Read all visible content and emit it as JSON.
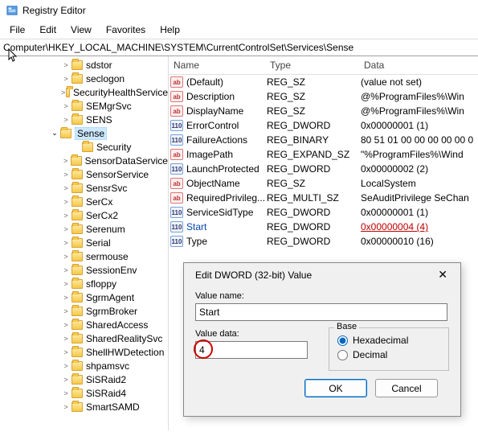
{
  "title": "Registry Editor",
  "menus": [
    "File",
    "Edit",
    "View",
    "Favorites",
    "Help"
  ],
  "address": "Computer\\HKEY_LOCAL_MACHINE\\SYSTEM\\CurrentControlSet\\Services\\Sense",
  "tree": [
    {
      "label": "sdstor",
      "chev": ">"
    },
    {
      "label": "seclogon",
      "chev": ">"
    },
    {
      "label": "SecurityHealthService",
      "chev": ">"
    },
    {
      "label": "SEMgrSvc",
      "chev": ">"
    },
    {
      "label": "SENS",
      "chev": ">"
    },
    {
      "label": "Sense",
      "chev": "v",
      "selected": true
    },
    {
      "label": "Security",
      "child": true
    },
    {
      "label": "SensorDataService",
      "chev": ">"
    },
    {
      "label": "SensorService",
      "chev": ">"
    },
    {
      "label": "SensrSvc",
      "chev": ">"
    },
    {
      "label": "SerCx",
      "chev": ">"
    },
    {
      "label": "SerCx2",
      "chev": ">"
    },
    {
      "label": "Serenum",
      "chev": ">"
    },
    {
      "label": "Serial",
      "chev": ">"
    },
    {
      "label": "sermouse",
      "chev": ">"
    },
    {
      "label": "SessionEnv",
      "chev": ">"
    },
    {
      "label": "sfloppy",
      "chev": ">"
    },
    {
      "label": "SgrmAgent",
      "chev": ">"
    },
    {
      "label": "SgrmBroker",
      "chev": ">"
    },
    {
      "label": "SharedAccess",
      "chev": ">"
    },
    {
      "label": "SharedRealitySvc",
      "chev": ">"
    },
    {
      "label": "ShellHWDetection",
      "chev": ">"
    },
    {
      "label": "shpamsvc",
      "chev": ">"
    },
    {
      "label": "SiSRaid2",
      "chev": ">"
    },
    {
      "label": "SiSRaid4",
      "chev": ">"
    },
    {
      "label": "SmartSAMD",
      "chev": ">"
    }
  ],
  "columns": {
    "name": "Name",
    "type": "Type",
    "data": "Data"
  },
  "values": [
    {
      "icon": "str",
      "name": "(Default)",
      "type": "REG_SZ",
      "data": "(value not set)"
    },
    {
      "icon": "str",
      "name": "Description",
      "type": "REG_SZ",
      "data": "@%ProgramFiles%\\Win"
    },
    {
      "icon": "str",
      "name": "DisplayName",
      "type": "REG_SZ",
      "data": "@%ProgramFiles%\\Win"
    },
    {
      "icon": "bin",
      "name": "ErrorControl",
      "type": "REG_DWORD",
      "data": "0x00000001 (1)"
    },
    {
      "icon": "bin",
      "name": "FailureActions",
      "type": "REG_BINARY",
      "data": "80 51 01 00 00 00 00 00 0"
    },
    {
      "icon": "str",
      "name": "ImagePath",
      "type": "REG_EXPAND_SZ",
      "data": "\"%ProgramFiles%\\Wind"
    },
    {
      "icon": "bin",
      "name": "LaunchProtected",
      "type": "REG_DWORD",
      "data": "0x00000002 (2)"
    },
    {
      "icon": "str",
      "name": "ObjectName",
      "type": "REG_SZ",
      "data": "LocalSystem"
    },
    {
      "icon": "str",
      "name": "RequiredPrivileg...",
      "type": "REG_MULTI_SZ",
      "data": "SeAuditPrivilege SeChan"
    },
    {
      "icon": "bin",
      "name": "ServiceSidType",
      "type": "REG_DWORD",
      "data": "0x00000001 (1)"
    },
    {
      "icon": "bin",
      "name": "Start",
      "type": "REG_DWORD",
      "data": "0x00000004 (4)",
      "hl": true
    },
    {
      "icon": "bin",
      "name": "Type",
      "type": "REG_DWORD",
      "data": "0x00000010 (16)"
    }
  ],
  "dialog": {
    "title": "Edit DWORD (32-bit) Value",
    "name_label": "Value name:",
    "name_value": "Start",
    "data_label": "Value data:",
    "data_value": "4",
    "base_label": "Base",
    "hex": "Hexadecimal",
    "dec": "Decimal",
    "ok": "OK",
    "cancel": "Cancel"
  },
  "icon_glyphs": {
    "str": "ab",
    "bin": "011\n110"
  }
}
